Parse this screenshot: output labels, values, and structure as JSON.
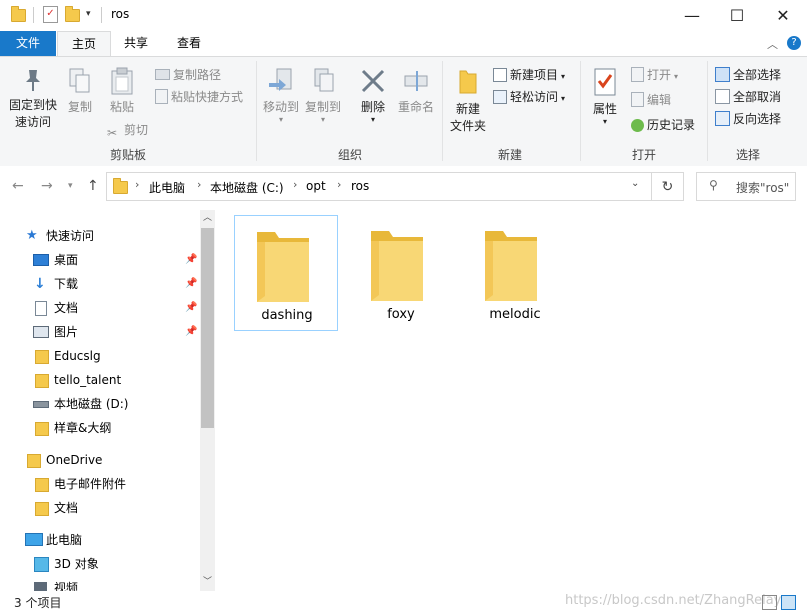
{
  "window": {
    "title": "ros",
    "minimize": "—",
    "maximize": "☐",
    "close": "✕"
  },
  "tabs": {
    "file": "文件",
    "home": "主页",
    "share": "共享",
    "view": "查看"
  },
  "ribbon": {
    "clipboard": {
      "label": "剪贴板",
      "pin_quick_access_line1": "固定到快",
      "pin_quick_access_line2": "速访问",
      "copy": "复制",
      "paste": "粘贴",
      "copy_path": "复制路径",
      "paste_shortcut": "粘贴快捷方式",
      "cut": "剪切"
    },
    "organize": {
      "label": "组织",
      "move_to": "移动到",
      "copy_to": "复制到",
      "delete": "删除",
      "rename": "重命名"
    },
    "new": {
      "label": "新建",
      "new_folder_line1": "新建",
      "new_folder_line2": "文件夹",
      "new_item": "新建项目",
      "easy_access": "轻松访问"
    },
    "open": {
      "label": "打开",
      "properties": "属性",
      "open": "打开",
      "edit": "编辑",
      "history": "历史记录"
    },
    "select": {
      "label": "选择",
      "select_all": "全部选择",
      "select_none": "全部取消",
      "invert": "反向选择"
    }
  },
  "address": {
    "crumbs": [
      "此电脑",
      "本地磁盘 (C:)",
      "opt",
      "ros"
    ],
    "search_placeholder": "搜索\"ros\""
  },
  "nav": {
    "quick_access": "快速访问",
    "quick_items": [
      "桌面",
      "下载",
      "文档",
      "图片",
      "Educslg",
      "tello_talent",
      "本地磁盘 (D:)",
      "样章&大纲"
    ],
    "onedrive": "OneDrive",
    "onedrive_items": [
      "电子邮件附件",
      "文档"
    ],
    "this_pc": "此电脑",
    "pc_items": [
      "3D 对象",
      "视频"
    ]
  },
  "folders": [
    "dashing",
    "foxy",
    "melodic"
  ],
  "status": {
    "count": "3 个项目"
  },
  "watermark": "https://blog.csdn.net/ZhangRelay",
  "colors": {
    "accent": "#1979ca",
    "folder": "#f5c94c",
    "selection_border": "#99d1ff"
  }
}
